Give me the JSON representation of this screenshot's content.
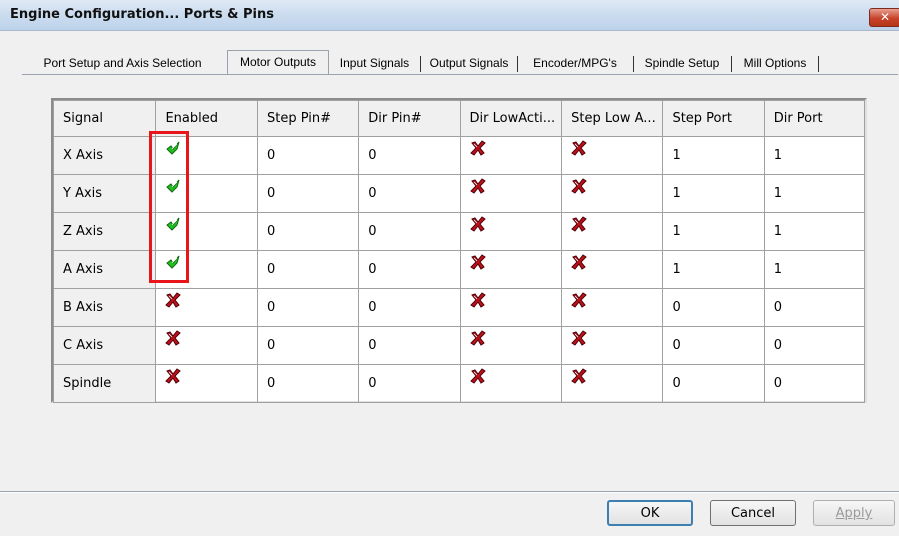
{
  "window": {
    "title": "Engine Configuration... Ports & Pins",
    "close_label": "✕"
  },
  "tabs": [
    {
      "label": "Port Setup and Axis Selection",
      "active": false
    },
    {
      "label": "Motor Outputs",
      "active": true
    },
    {
      "label": "Input Signals",
      "active": false
    },
    {
      "label": "Output Signals",
      "active": false
    },
    {
      "label": "Encoder/MPG's",
      "active": false
    },
    {
      "label": "Spindle Setup",
      "active": false
    },
    {
      "label": "Mill Options",
      "active": false
    }
  ],
  "grid": {
    "columns": [
      "Signal",
      "Enabled",
      "Step Pin#",
      "Dir Pin#",
      "Dir LowActi...",
      "Step Low A...",
      "Step Port",
      "Dir Port"
    ],
    "rows": [
      {
        "signal": "X Axis",
        "enabled": true,
        "step_pin": "0",
        "dir_pin": "0",
        "dir_low": false,
        "step_low": false,
        "step_port": "1",
        "dir_port": "1"
      },
      {
        "signal": "Y Axis",
        "enabled": true,
        "step_pin": "0",
        "dir_pin": "0",
        "dir_low": false,
        "step_low": false,
        "step_port": "1",
        "dir_port": "1"
      },
      {
        "signal": "Z Axis",
        "enabled": true,
        "step_pin": "0",
        "dir_pin": "0",
        "dir_low": false,
        "step_low": false,
        "step_port": "1",
        "dir_port": "1"
      },
      {
        "signal": "A Axis",
        "enabled": true,
        "step_pin": "0",
        "dir_pin": "0",
        "dir_low": false,
        "step_low": false,
        "step_port": "1",
        "dir_port": "1"
      },
      {
        "signal": "B Axis",
        "enabled": false,
        "step_pin": "0",
        "dir_pin": "0",
        "dir_low": false,
        "step_low": false,
        "step_port": "0",
        "dir_port": "0"
      },
      {
        "signal": "C Axis",
        "enabled": false,
        "step_pin": "0",
        "dir_pin": "0",
        "dir_low": false,
        "step_low": false,
        "step_port": "0",
        "dir_port": "0"
      },
      {
        "signal": "Spindle",
        "enabled": false,
        "step_pin": "0",
        "dir_pin": "0",
        "dir_low": false,
        "step_low": false,
        "step_port": "0",
        "dir_port": "0"
      }
    ]
  },
  "buttons": {
    "ok": "OK",
    "cancel": "Cancel",
    "apply": "Apply"
  },
  "icons": {
    "check": "green-check-icon",
    "cross": "red-x-icon"
  },
  "colors": {
    "highlight": "#e8151a",
    "check": "#22c022",
    "cross": "#c0101a"
  }
}
